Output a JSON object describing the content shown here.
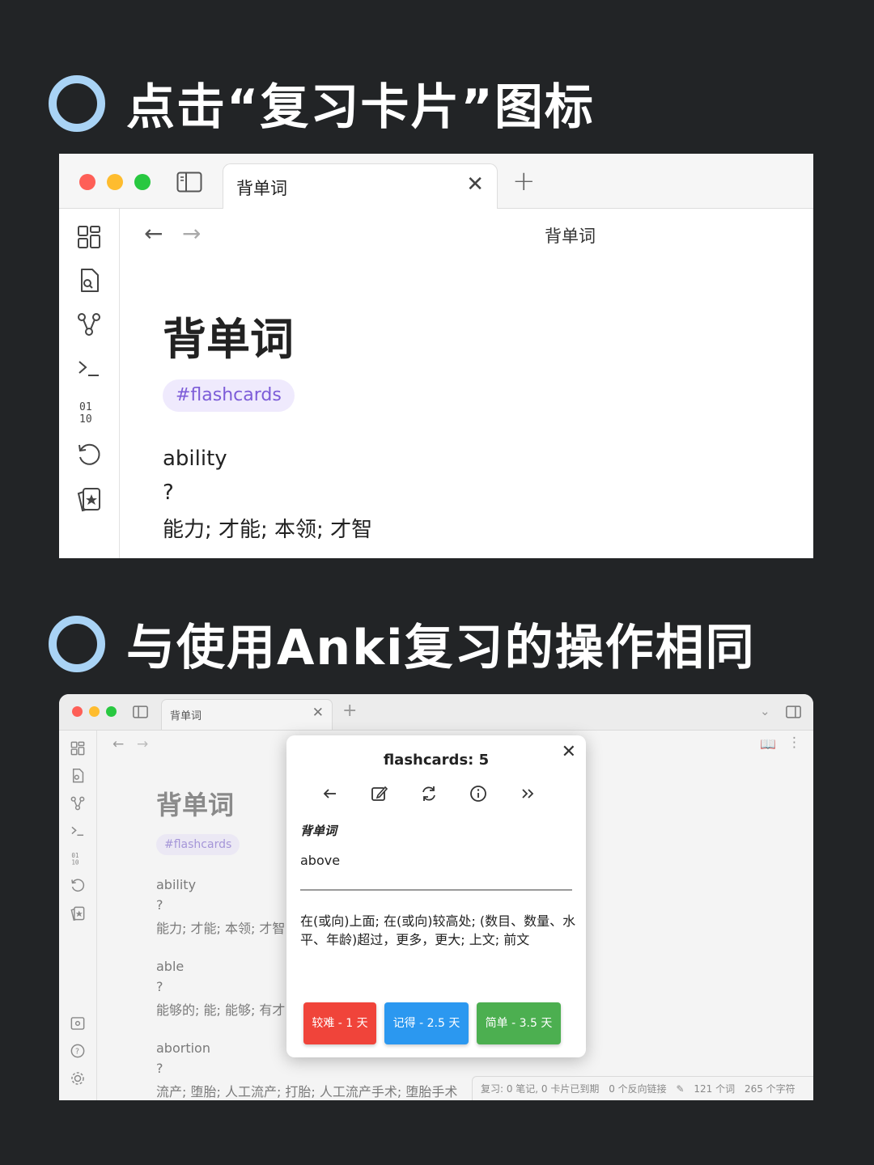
{
  "heading1": "点击“复习卡片”图标",
  "heading2": "与使用Anki复习的操作相同",
  "shot1": {
    "tab_label": "背单词",
    "view_title": "背单词",
    "note_title": "背单词",
    "tag": "#flashcards",
    "lines": [
      "ability",
      "?",
      "能力; 才能; 本领; 才智"
    ]
  },
  "shot2": {
    "tab_label": "背单词",
    "note_title": "背单词",
    "tag": "#flashcards",
    "lines": [
      "ability",
      "?",
      "能力; 才能; 本领; 才智",
      "able",
      "?",
      "能够的; 能; 能够; 有才",
      "abortion",
      "?",
      "流产; 堕胎; 人工流产; 打胎; 人工流产手术; 堕胎手术"
    ],
    "status": {
      "review": "复习: 0 笔记, 0 卡片已到期",
      "backlinks": "0 个反向链接",
      "words": "121 个词",
      "chars": "265 个字符"
    },
    "modal": {
      "title": "flashcards: 5",
      "deck": "背单词",
      "front": "above",
      "back": "在(或向)上面; 在(或向)较高处; (数目、数量、水平、年龄)超过，更多，更大; 上文; 前文",
      "buttons": {
        "hard": "较难 - 1 天",
        "good": "记得 - 2.5 天",
        "easy": "简单 - 3.5 天"
      }
    }
  },
  "colors": {
    "accent_ring": "#a9d3f5",
    "tag_text": "#7c5cd8",
    "hard": "#f0443a",
    "good": "#2b98f0",
    "easy": "#4caf50"
  }
}
